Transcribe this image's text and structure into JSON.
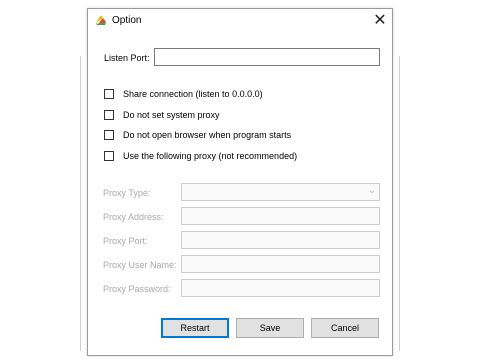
{
  "window": {
    "title": "Option",
    "close_glyph": "✕",
    "icon": "app-logo-icon"
  },
  "listen_port": {
    "label": "Listen Port:",
    "value": ""
  },
  "options": [
    {
      "label": "Share connection (listen to 0.0.0.0)",
      "checked": false
    },
    {
      "label": "Do not set system proxy",
      "checked": false
    },
    {
      "label": "Do not open browser when program starts",
      "checked": false
    },
    {
      "label": "Use the following proxy (not recommended)",
      "checked": false
    }
  ],
  "proxy": {
    "type_label": "Proxy Type:",
    "type_value": "",
    "address_label": "Proxy Address:",
    "port_label": "Proxy Port:",
    "user_label": "Proxy User Name:",
    "password_label": "Proxy Password:"
  },
  "buttons": {
    "restart": "Restart",
    "save": "Save",
    "cancel": "Cancel"
  }
}
